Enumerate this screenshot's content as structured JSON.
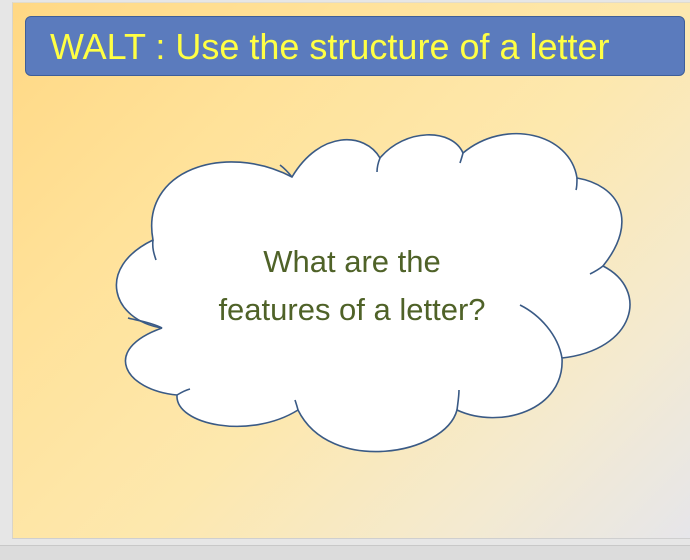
{
  "slide": {
    "title": "WALT : Use the structure of a letter",
    "cloud_line_1": "What are the",
    "cloud_line_2": "features of a letter?"
  },
  "colors": {
    "title_fill": "#5b7bbd",
    "title_text": "#ffff44",
    "cloud_text": "#4f6228",
    "cloud_stroke": "#3a5a85",
    "background_warm": "#ffd884"
  },
  "icons": {
    "cloud": "thought-cloud-shape"
  }
}
